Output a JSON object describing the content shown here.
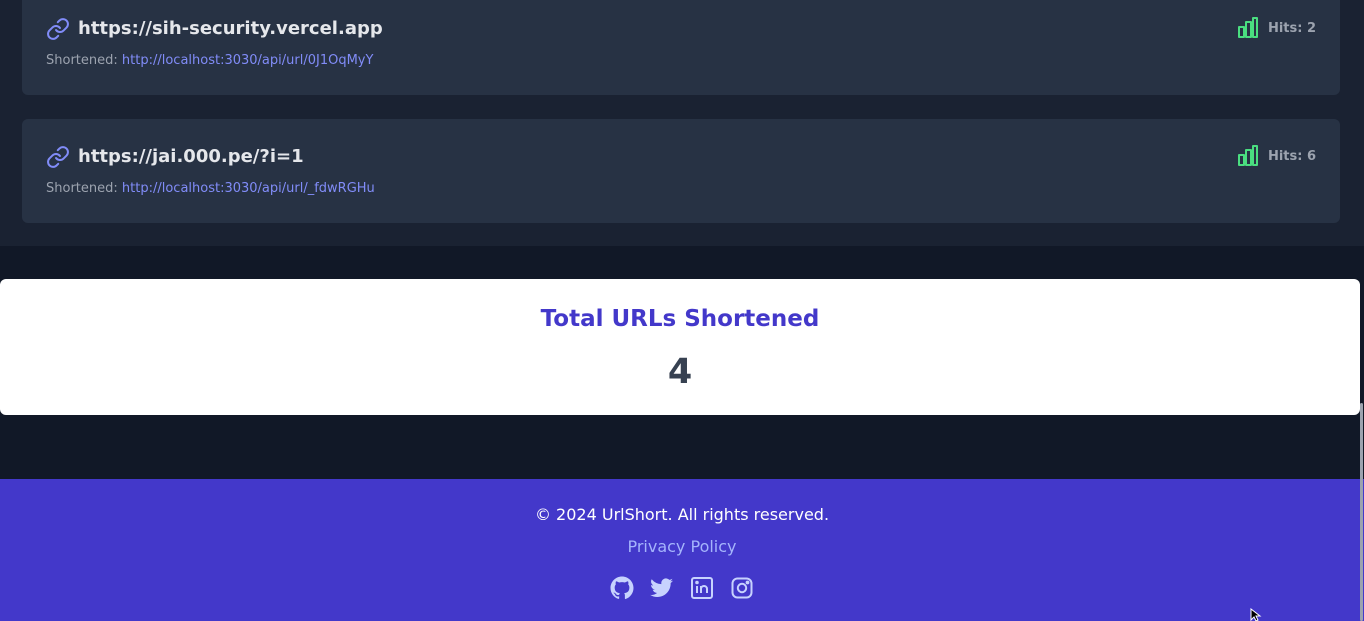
{
  "links": [
    {
      "original": "https://sih-security.vercel.app",
      "shortened_label": "Shortened:",
      "short_url": "http://localhost:3030/api/url/0J1OqMyY",
      "hits": "Hits: 2"
    },
    {
      "original": "https://jai.000.pe/?i=1",
      "shortened_label": "Shortened:",
      "short_url": "http://localhost:3030/api/url/_fdwRGHu",
      "hits": "Hits: 6"
    }
  ],
  "stats": {
    "title": "Total URLs Shortened",
    "count": "4"
  },
  "footer": {
    "copyright": "© 2024 UrlShort. All rights reserved.",
    "privacy": "Privacy Policy",
    "socials": [
      "github-icon",
      "twitter-icon",
      "linkedin-icon",
      "instagram-icon"
    ]
  },
  "colors": {
    "background": "#111827",
    "card": "#273244",
    "accent": "#4338ca",
    "link": "#818cf8",
    "hits_icon": "#4ade80"
  }
}
